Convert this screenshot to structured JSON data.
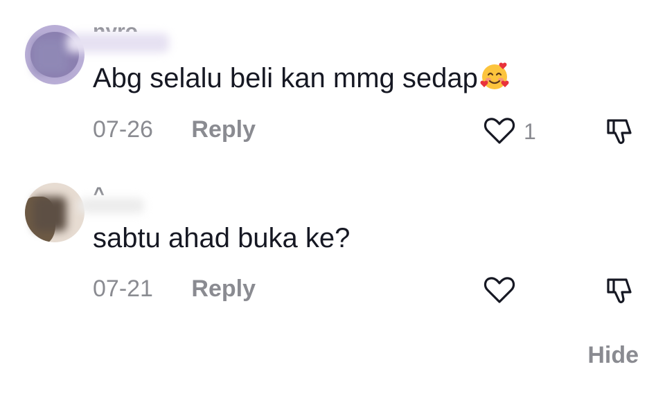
{
  "comments": [
    {
      "username": "nyro",
      "text": "Abg selalu beli kan mmg sedap",
      "emoji": "smiling-face-with-hearts",
      "date": "07-26",
      "reply_label": "Reply",
      "like_count": "1"
    },
    {
      "username": "^",
      "text": "sabtu ahad buka ke?",
      "date": "07-21",
      "reply_label": "Reply",
      "like_count": ""
    }
  ],
  "footer": {
    "hide_label": "Hide"
  },
  "colors": {
    "text": "#161823",
    "muted": "#8a8b91",
    "background": "#ffffff"
  }
}
